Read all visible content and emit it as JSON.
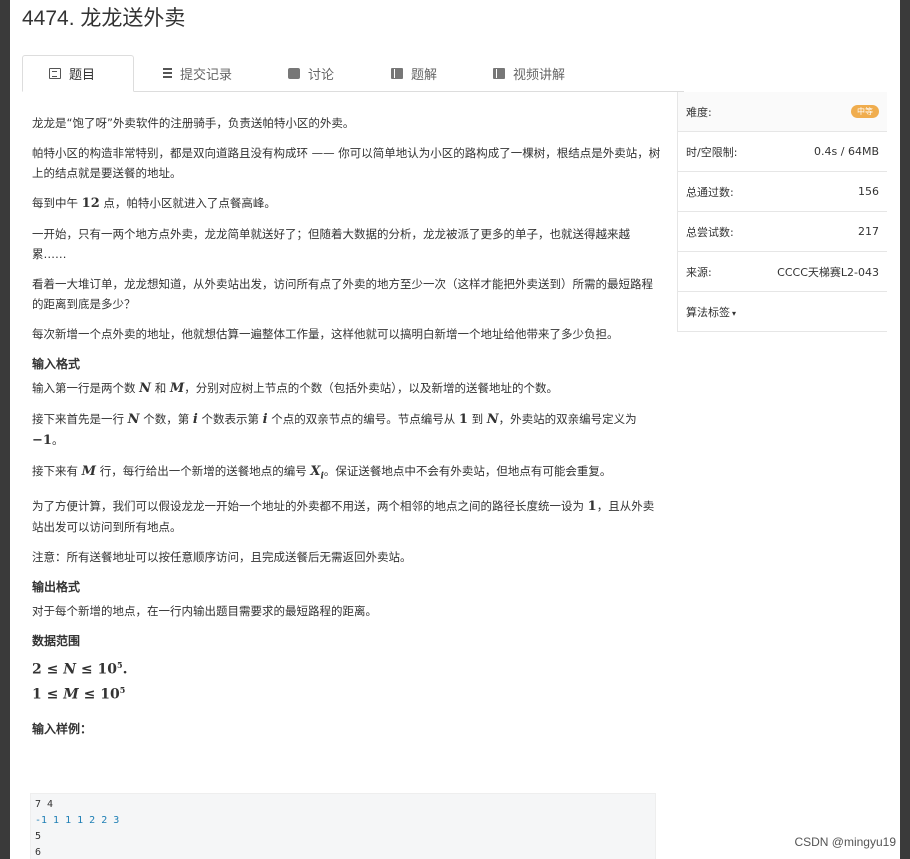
{
  "page": {
    "title": "4474. 龙龙送外卖"
  },
  "tabs": [
    {
      "label": "题目",
      "icon": "list-icon"
    },
    {
      "label": "提交记录",
      "icon": "list-icon"
    },
    {
      "label": "讨论",
      "icon": "chat-icon"
    },
    {
      "label": "题解",
      "icon": "book-icon"
    },
    {
      "label": "视频讲解",
      "icon": "book-icon"
    }
  ],
  "problem": {
    "p1": "龙龙是“饱了呀”外卖软件的注册骑手，负责送帕特小区的外卖。",
    "p2": "帕特小区的构造非常特别，都是双向道路且没有构成环 —— 你可以简单地认为小区的路构成了一棵树，根结点是外卖站，树上的结点就是要送餐的地址。",
    "p3a": "每到中午 ",
    "p3n": "12",
    "p3b": " 点，帕特小区就进入了点餐高峰。",
    "p4": "一开始，只有一两个地方点外卖，龙龙简单就送好了；但随着大数据的分析，龙龙被派了更多的单子，也就送得越来越累……",
    "p5": "看着一大堆订单，龙龙想知道，从外卖站出发，访问所有点了外卖的地方至少一次（这样才能把外卖送到）所需的最短路程的距离到底是多少？",
    "p6": "每次新增一个点外卖的地址，他就想估算一遍整体工作量，这样他就可以搞明白新增一个地址给他带来了多少负担。",
    "input_heading": "输入格式",
    "in1a": "输入第一行是两个数 ",
    "in1N": "N",
    "in1b": " 和 ",
    "in1M": "M",
    "in1c": "，分别对应树上节点的个数（包括外卖站），以及新增的送餐地址的个数。",
    "in2a": "接下来首先是一行 ",
    "in2N": "N",
    "in2b": " 个数，第 ",
    "in2i": "i",
    "in2c": " 个数表示第 ",
    "in2i2": "i",
    "in2d": " 个点的双亲节点的编号。节点编号从 ",
    "in2one": "1",
    "in2e": " 到 ",
    "in2N2": "N",
    "in2f": "，外卖站的双亲编号定义为 ",
    "in2neg": "−1",
    "in2g": "。",
    "in3a": "接下来有 ",
    "in3M": "M",
    "in3b": " 行，每行给出一个新增的送餐地点的编号 ",
    "in3X": "X",
    "in3sub": "i",
    "in3c": "。保证送餐地点中不会有外卖站，但地点有可能会重复。",
    "in4a": "为了方便计算，我们可以假设龙龙一开始一个地址的外卖都不用送，两个相邻的地点之间的路径长度统一设为 ",
    "in4one": "1",
    "in4b": "，且从外卖站出发可以访问到所有地点。",
    "in5": "注意：所有送餐地址可以按任意顺序访问，且完成送餐后无需返回外卖站。",
    "output_heading": "输出格式",
    "out1": "对于每个新增的地点，在一行内输出题目需要求的最短路程的距离。",
    "range_heading": "数据范围",
    "range1a": "2 ≤ ",
    "range1v": "N",
    "range1b": " ≤ 10",
    "range1e": "5",
    "range1c": ".",
    "range2a": "1 ≤ ",
    "range2v": "M",
    "range2b": " ≤ 10",
    "range2e": "5",
    "sample_heading": "输入样例："
  },
  "sample_lines": [
    "7 4",
    "-1 1 1 1 2 2 3",
    "5",
    "6"
  ],
  "sidebar": [
    {
      "label": "难度:",
      "value": "中等"
    },
    {
      "label": "时/空限制:",
      "value": "0.4s / 64MB"
    },
    {
      "label": "总通过数:",
      "value": "156"
    },
    {
      "label": "总尝试数:",
      "value": "217"
    },
    {
      "label": "来源:",
      "value": "CCCC天梯赛L2-043"
    },
    {
      "label": "算法标签",
      "value": ""
    }
  ],
  "watermark": "CSDN @mingyu19",
  "colors": {
    "badge": "#f0ad4e",
    "code_blue": "#1f7fb5"
  }
}
